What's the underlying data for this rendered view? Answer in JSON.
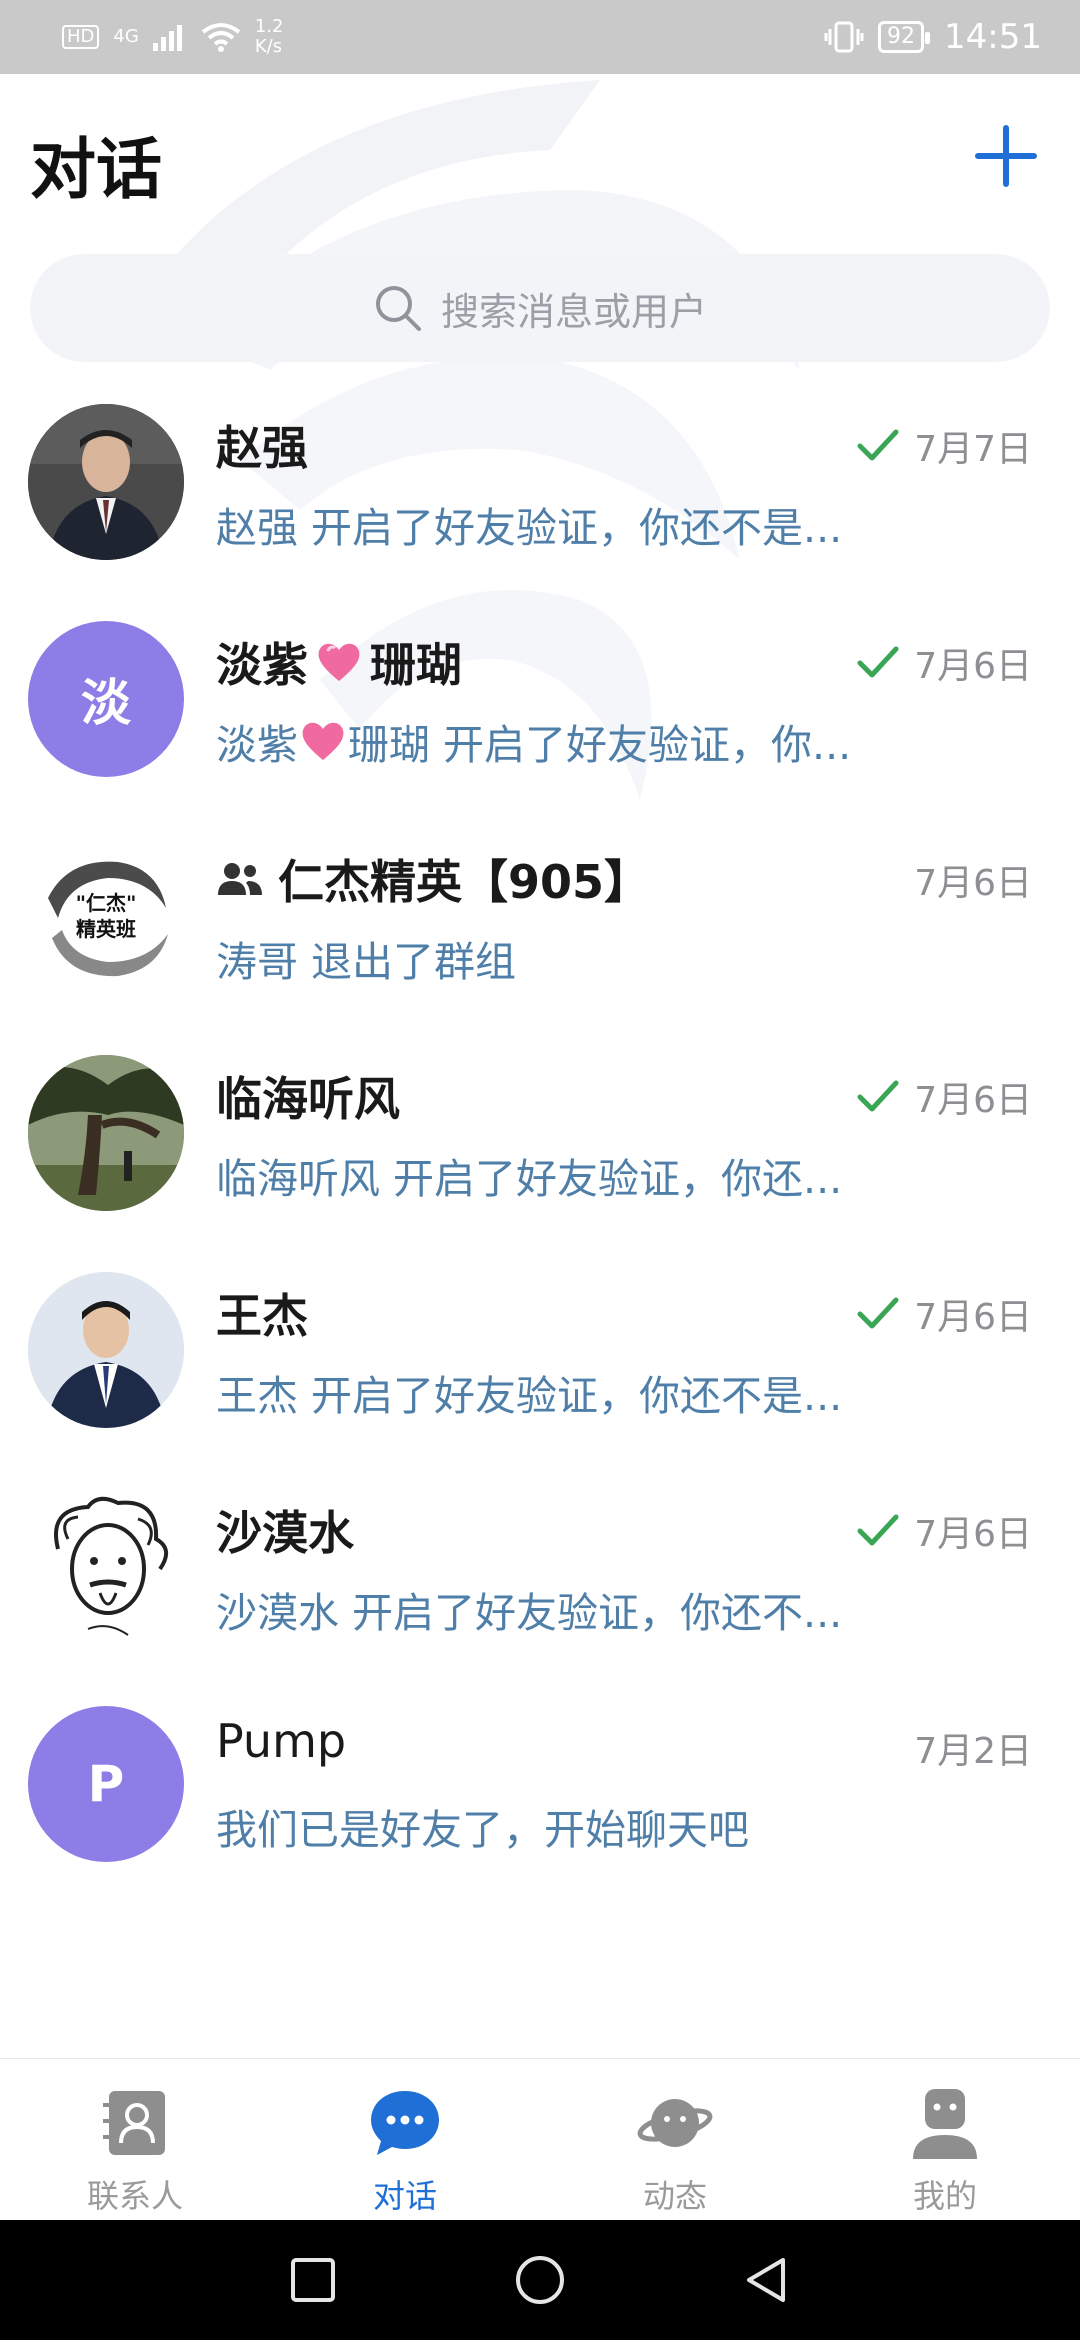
{
  "status_bar": {
    "hd": "HD",
    "network": "4G",
    "speed_value": "1.2",
    "speed_unit": "K/s",
    "battery": "92",
    "time": "14:51"
  },
  "header": {
    "title": "对话"
  },
  "search": {
    "placeholder": "搜索消息或用户"
  },
  "conversations": [
    {
      "name": "赵强",
      "date": "7月7日",
      "read": true,
      "preview": "赵强 开启了好友验证，你还不是...",
      "avatar": "photo-man-suit"
    },
    {
      "name_a": "淡紫",
      "name_b": "珊瑚",
      "date": "7月6日",
      "read": true,
      "preview_a": "淡紫",
      "preview_b": "珊瑚 开启了好友验证，你...",
      "avatar_text": "淡",
      "avatar_color": "#8d7de6"
    },
    {
      "name": "仁杰精英【905】",
      "date": "7月6日",
      "read": false,
      "preview": "涛哥 退出了群组",
      "avatar": "ink-logo",
      "group": true
    },
    {
      "name": "临海听风",
      "date": "7月6日",
      "read": true,
      "preview": "临海听风 开启了好友验证，你还...",
      "avatar": "photo-tree"
    },
    {
      "name": "王杰",
      "date": "7月6日",
      "read": true,
      "preview": "王杰 开启了好友验证，你还不是...",
      "avatar": "photo-man-tie"
    },
    {
      "name": "沙漠水",
      "date": "7月6日",
      "read": true,
      "preview": "沙漠水 开启了好友验证，你还不...",
      "avatar": "sketch-einstein"
    },
    {
      "name": "Pump",
      "date": "7月2日",
      "read": false,
      "preview": "我们已是好友了，开始聊天吧",
      "avatar_text": "P",
      "avatar_color": "#8d7de6"
    }
  ],
  "bottom_nav": {
    "items": [
      {
        "label": "联系人",
        "icon": "contacts-icon",
        "active": false
      },
      {
        "label": "对话",
        "icon": "chat-bubble-icon",
        "active": true
      },
      {
        "label": "动态",
        "icon": "planet-icon",
        "active": false
      },
      {
        "label": "我的",
        "icon": "robot-profile-icon",
        "active": false
      }
    ]
  },
  "colors": {
    "accent": "#1f6fd6",
    "preview_text": "#4f7fa8",
    "check": "#3aa655",
    "avatar_purple": "#8d7de6"
  }
}
